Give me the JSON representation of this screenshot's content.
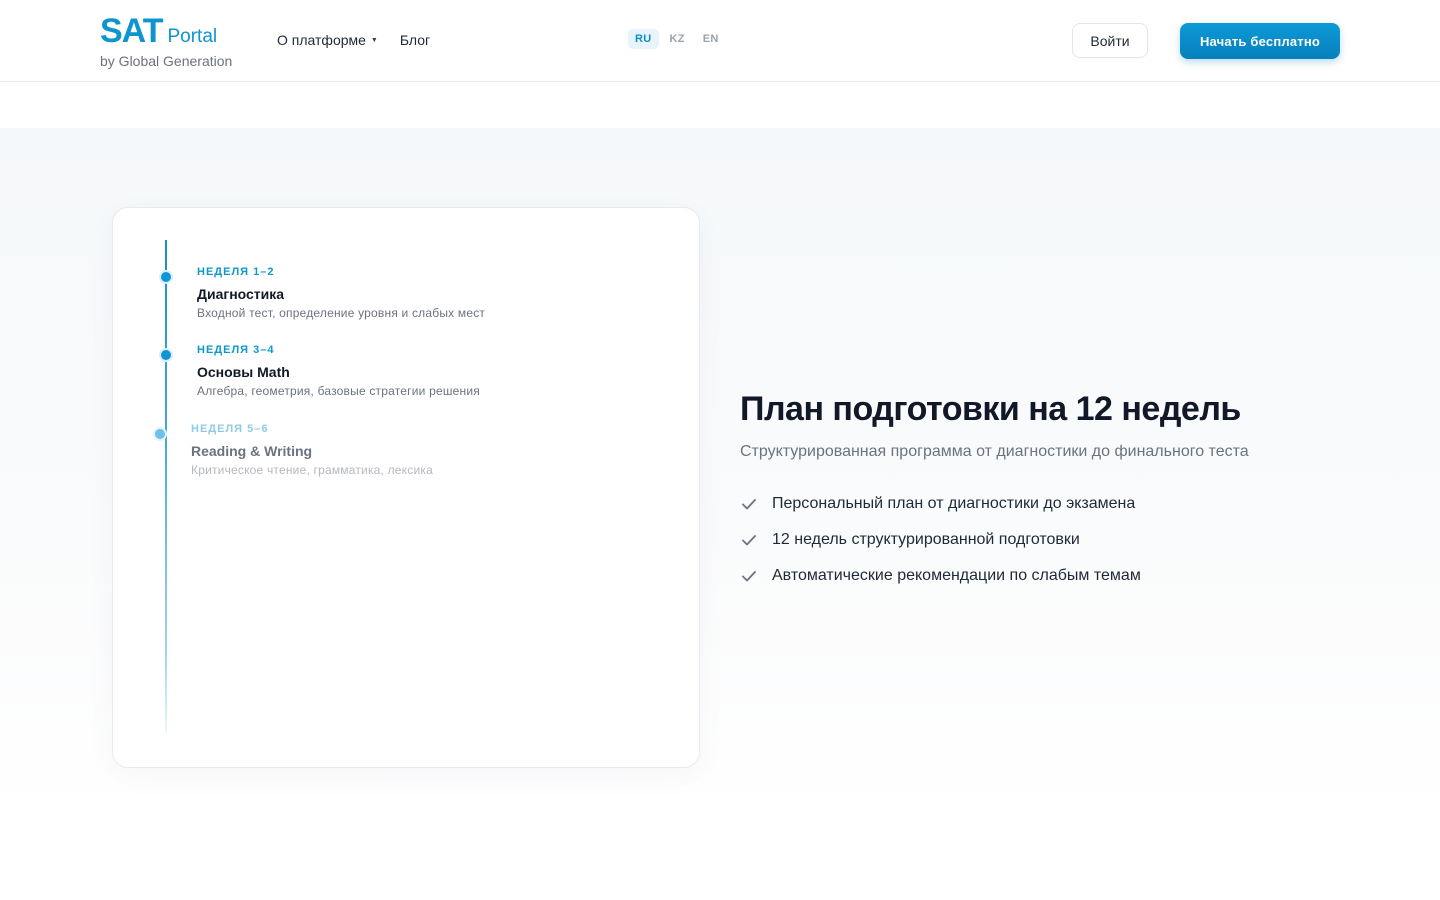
{
  "header": {
    "logo": {
      "brand": "SAT",
      "product": "Portal",
      "byline": "by Global Generation"
    },
    "nav": [
      {
        "label": "О платформе",
        "has_dropdown": true
      },
      {
        "label": "Блог",
        "has_dropdown": false
      }
    ],
    "languages": [
      {
        "code": "RU",
        "active": true
      },
      {
        "code": "KZ",
        "active": false
      },
      {
        "code": "EN",
        "active": false
      }
    ],
    "login_label": "Войти",
    "cta_label": "Начать бесплатно"
  },
  "timeline": [
    {
      "week": "НЕДЕЛЯ 1–2",
      "title": "Диагностика",
      "description": "Входной тест, определение уровня и слабых мест"
    },
    {
      "week": "НЕДЕЛЯ 3–4",
      "title": "Основы Math",
      "description": "Алгебра, геометрия, базовые стратегии решения"
    },
    {
      "week": "НЕДЕЛЯ 5–6",
      "title": "Reading & Writing",
      "description": "Критическое чтение, грамматика, лексика"
    }
  ],
  "content": {
    "headline": "План подготовки на 12 недель",
    "subheadline": "Структурированная программа от диагностики до финального теста",
    "features": [
      "Персональный план от диагностики до экзамена",
      "12 недель структурированной подготовки",
      "Автоматические рекомендации по слабым темам"
    ]
  },
  "colors": {
    "brand": "#0e95cf",
    "cta": "#0780bd",
    "text_primary": "#111827",
    "text_muted": "#6b7280"
  }
}
